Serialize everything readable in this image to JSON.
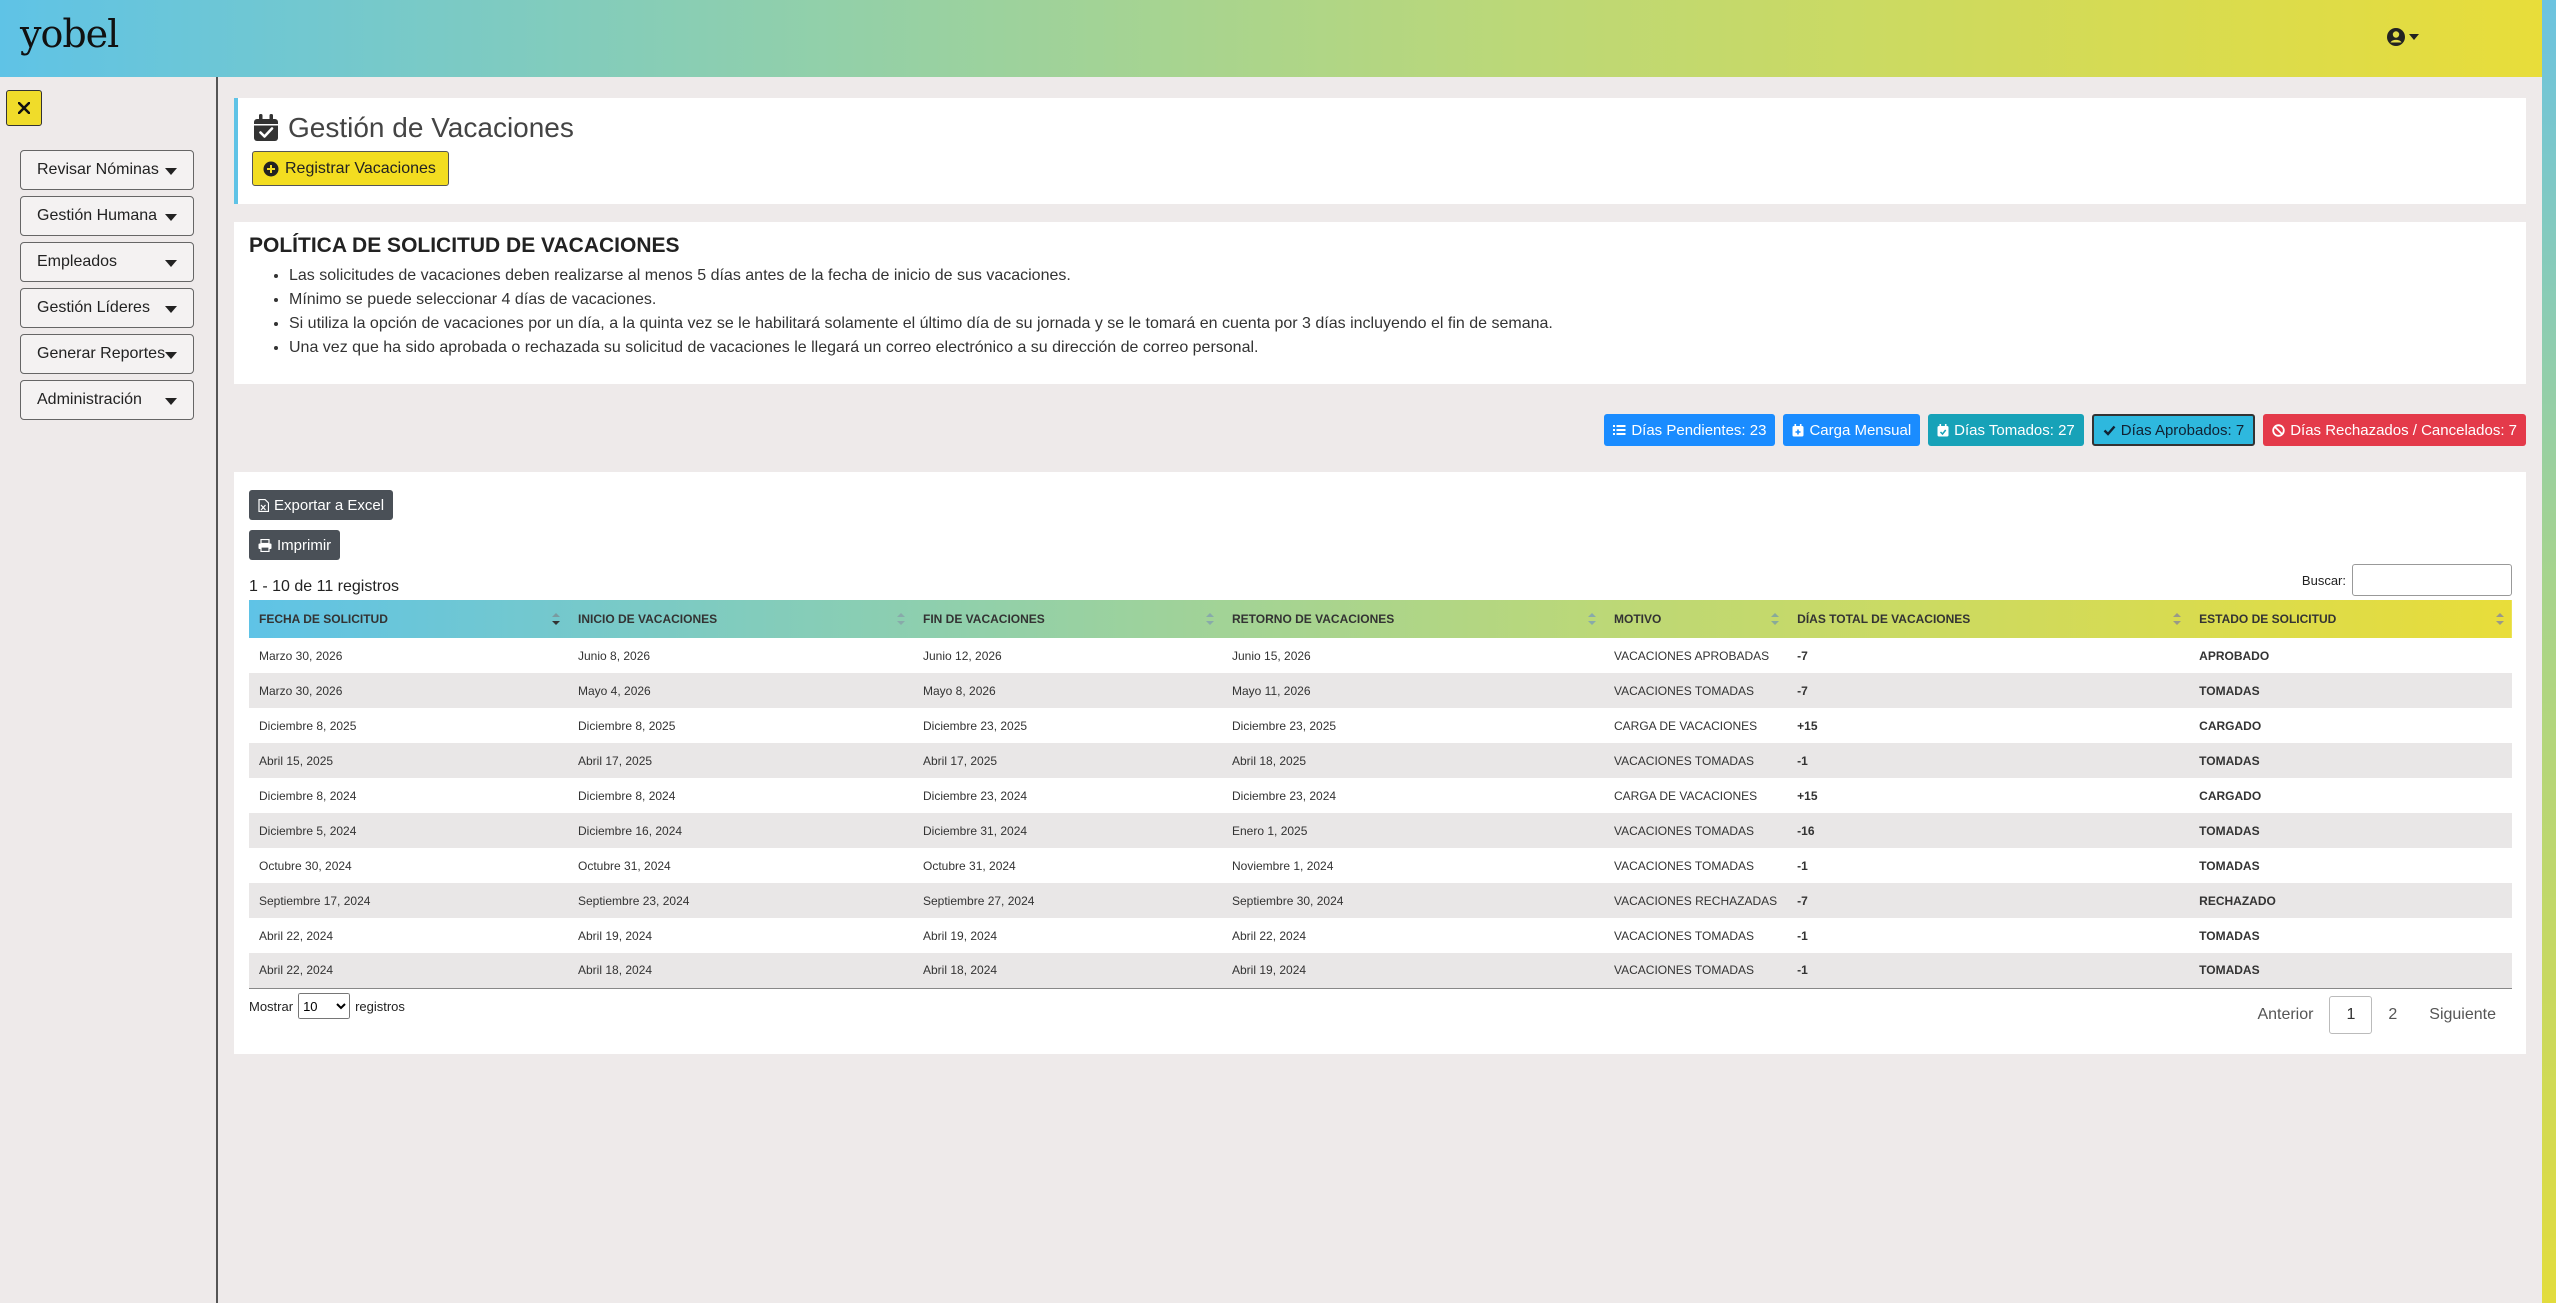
{
  "header": {
    "logo": "yobel",
    "user_icon": "user-circle-icon"
  },
  "sidebar": {
    "close_icon": "close-icon",
    "items": [
      {
        "label": "Revisar Nóminas"
      },
      {
        "label": "Gestión Humana"
      },
      {
        "label": "Empleados"
      },
      {
        "label": "Gestión Líderes"
      },
      {
        "label": "Generar Reportes"
      },
      {
        "label": "Administración"
      }
    ]
  },
  "page": {
    "title": "Gestión de Vacaciones",
    "register_button": "Registrar Vacaciones"
  },
  "policy": {
    "title": "POLÍTICA DE SOLICITUD DE VACACIONES",
    "items": [
      "Las solicitudes de vacaciones deben realizarse al menos 5 días antes de la fecha de inicio de sus vacaciones.",
      "Mínimo se puede seleccionar 4 días de vacaciones.",
      "Si utiliza la opción de vacaciones por un día, a la quinta vez se le habilitará solamente el último día de su jornada y se le tomará en cuenta por 3 días incluyendo el fin de semana.",
      "Una vez que ha sido aprobada o rechazada su solicitud de vacaciones le llegará un correo electrónico a su dirección de correo personal."
    ]
  },
  "badges": {
    "pendientes": "Días Pendientes: 23",
    "carga": "Carga Mensual",
    "tomados": "Días Tomados: 27",
    "aprobados": "Días Aprobados: 7",
    "rechazados": "Días Rechazados / Cancelados: 7"
  },
  "table": {
    "export_button": "Exportar a Excel",
    "print_button": "Imprimir",
    "records_info": "1 - 10 de 11 registros",
    "search_label": "Buscar:",
    "search_value": "",
    "columns": [
      "FECHA DE SOLICITUD",
      "INICIO DE VACACIONES",
      "FIN DE VACACIONES",
      "RETORNO DE VACACIONES",
      "MOTIVO",
      "DÍAS TOTAL DE VACACIONES",
      "ESTADO DE SOLICITUD"
    ],
    "rows": [
      {
        "fecha": "Marzo 30, 2026",
        "inicio": "Junio 8, 2026",
        "fin": "Junio 12, 2026",
        "retorno": "Junio 15, 2026",
        "motivo": "VACACIONES APROBADAS",
        "dias": "-7",
        "estado": "APROBADO",
        "estado_class": "st-aprobado"
      },
      {
        "fecha": "Marzo 30, 2026",
        "inicio": "Mayo 4, 2026",
        "fin": "Mayo 8, 2026",
        "retorno": "Mayo 11, 2026",
        "motivo": "VACACIONES TOMADAS",
        "dias": "-7",
        "estado": "TOMADAS",
        "estado_class": "st-tomadas"
      },
      {
        "fecha": "Diciembre 8, 2025",
        "inicio": "Diciembre 8, 2025",
        "fin": "Diciembre 23, 2025",
        "retorno": "Diciembre 23, 2025",
        "motivo": "CARGA DE VACACIONES",
        "dias": "+15",
        "estado": "CARGADO",
        "estado_class": "st-cargado"
      },
      {
        "fecha": "Abril 15, 2025",
        "inicio": "Abril 17, 2025",
        "fin": "Abril 17, 2025",
        "retorno": "Abril 18, 2025",
        "motivo": "VACACIONES TOMADAS",
        "dias": "-1",
        "estado": "TOMADAS",
        "estado_class": "st-tomadas"
      },
      {
        "fecha": "Diciembre 8, 2024",
        "inicio": "Diciembre 8, 2024",
        "fin": "Diciembre 23, 2024",
        "retorno": "Diciembre 23, 2024",
        "motivo": "CARGA DE VACACIONES",
        "dias": "+15",
        "estado": "CARGADO",
        "estado_class": "st-cargado"
      },
      {
        "fecha": "Diciembre 5, 2024",
        "inicio": "Diciembre 16, 2024",
        "fin": "Diciembre 31, 2024",
        "retorno": "Enero 1, 2025",
        "motivo": "VACACIONES TOMADAS",
        "dias": "-16",
        "estado": "TOMADAS",
        "estado_class": "st-tomadas"
      },
      {
        "fecha": "Octubre 30, 2024",
        "inicio": "Octubre 31, 2024",
        "fin": "Octubre 31, 2024",
        "retorno": "Noviembre 1, 2024",
        "motivo": "VACACIONES TOMADAS",
        "dias": "-1",
        "estado": "TOMADAS",
        "estado_class": "st-tomadas"
      },
      {
        "fecha": "Septiembre 17, 2024",
        "inicio": "Septiembre 23, 2024",
        "fin": "Septiembre 27, 2024",
        "retorno": "Septiembre 30, 2024",
        "motivo": "VACACIONES RECHAZADAS",
        "dias": "-7",
        "estado": "RECHAZADO",
        "estado_class": "st-rechazado"
      },
      {
        "fecha": "Abril 22, 2024",
        "inicio": "Abril 19, 2024",
        "fin": "Abril 19, 2024",
        "retorno": "Abril 22, 2024",
        "motivo": "VACACIONES TOMADAS",
        "dias": "-1",
        "estado": "TOMADAS",
        "estado_class": "st-tomadas"
      },
      {
        "fecha": "Abril 22, 2024",
        "inicio": "Abril 18, 2024",
        "fin": "Abril 18, 2024",
        "retorno": "Abril 19, 2024",
        "motivo": "VACACIONES TOMADAS",
        "dias": "-1",
        "estado": "TOMADAS",
        "estado_class": "st-tomadas"
      }
    ],
    "show_label": "Mostrar",
    "show_value": "10",
    "records_label": "registros",
    "pager": {
      "prev": "Anterior",
      "page1": "1",
      "page2": "2",
      "next": "Siguiente"
    }
  }
}
